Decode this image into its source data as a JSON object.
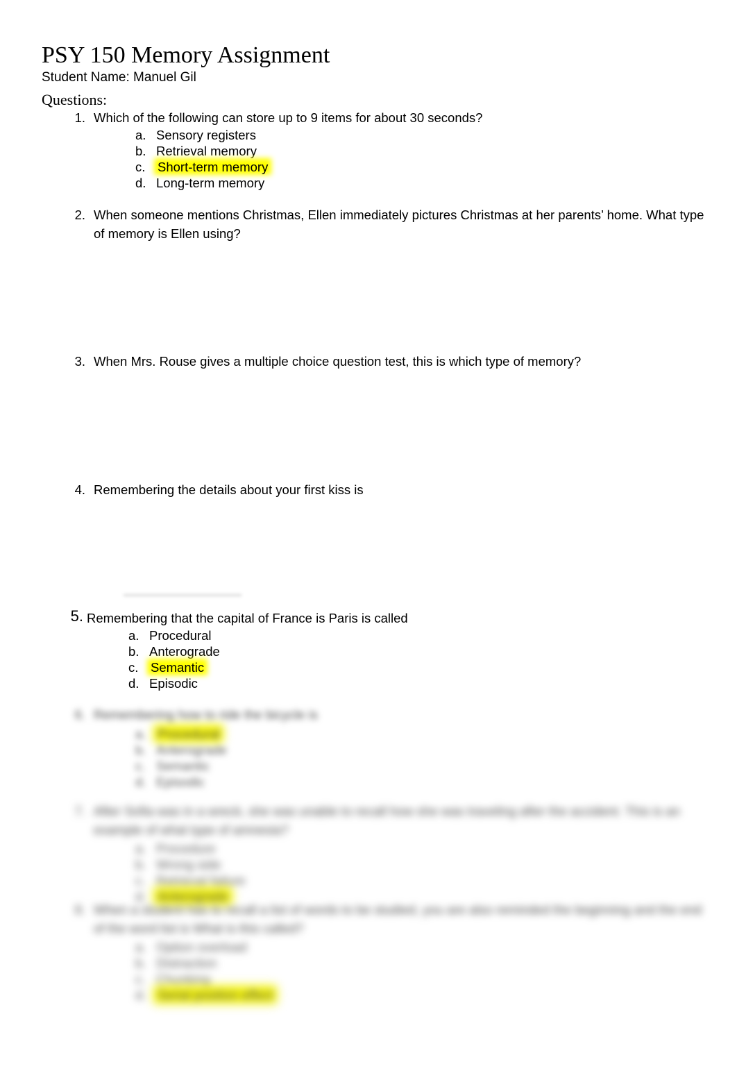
{
  "document": {
    "title_course": "PSY 150 ",
    "title_rest": "Memory Assignment",
    "student_label": "Student Name:  Manuel Gil",
    "questions_label": "Questions:",
    "highlight_color": "#ffff00",
    "text_color": "#000000",
    "page_background": "#ffffff"
  },
  "questions": [
    {
      "number": "1.",
      "text": "Which of the following can store up to 9 items for about 30 seconds?",
      "options": [
        {
          "letter": "a.",
          "text": "Sensory registers",
          "highlighted": false
        },
        {
          "letter": "b.",
          "text": "Retrieval memory",
          "highlighted": false
        },
        {
          "letter": "c.",
          "text": "Short-term memory",
          "highlighted": true
        },
        {
          "letter": "d.",
          "text": "Long-term memory",
          "highlighted": false
        }
      ]
    },
    {
      "number": "2.",
      "text": "When someone mentions Christmas, Ellen immediately pictures Christmas at her parents’ home. What type of memory is Ellen using?",
      "options": []
    },
    {
      "number": "3.",
      "text": "When Mrs. Rouse gives a multiple choice question test, this is which type of memory?",
      "options": []
    },
    {
      "number": "4.",
      "text": "Remembering the details about your first kiss is",
      "options": []
    },
    {
      "number": "5.",
      "text": "Remembering that the capital of France is Paris is called",
      "options": [
        {
          "letter": "a.",
          "text": "Procedural",
          "highlighted": false
        },
        {
          "letter": "b.",
          "text": "Anterograde",
          "highlighted": false
        },
        {
          "letter": "c.",
          "text": "Semantic",
          "highlighted": true
        },
        {
          "letter": "d.",
          "text": "Episodic",
          "highlighted": false
        }
      ]
    }
  ],
  "blurred_questions": [
    {
      "number": "6.",
      "text": "Remembering how to ride the bicycle is",
      "legible": false,
      "options": [
        {
          "letter": "a.",
          "text": "Procedural",
          "highlighted": true
        },
        {
          "letter": "b.",
          "text": "Anterograde",
          "highlighted": false
        },
        {
          "letter": "c.",
          "text": "Semantic",
          "highlighted": false
        },
        {
          "letter": "d.",
          "text": "Episodic",
          "highlighted": false
        }
      ]
    },
    {
      "number": "7.",
      "text": "After Sofia was in a wreck, she was unable to recall how she was traveling after the accident. This is an example of what type of amnesia?",
      "legible": false,
      "options": [
        {
          "letter": "a.",
          "text": "Procedure",
          "highlighted": false
        },
        {
          "letter": "b.",
          "text": "Wrong side",
          "highlighted": false
        },
        {
          "letter": "c.",
          "text": "Retrieval failure",
          "highlighted": false
        },
        {
          "letter": "d.",
          "text": "Anterograde",
          "highlighted": true
        }
      ]
    },
    {
      "number": "8.",
      "text": "When a student has to recall a list of words to be studied, you are also reminded the beginning and the end of the word list is What is this called?",
      "legible": false,
      "options": [
        {
          "letter": "a.",
          "text": "Option overload",
          "highlighted": false
        },
        {
          "letter": "b.",
          "text": "Distraction",
          "highlighted": false
        },
        {
          "letter": "c.",
          "text": "Chunking",
          "highlighted": false
        },
        {
          "letter": "d.",
          "text": "Serial position effect",
          "highlighted": true
        }
      ]
    }
  ]
}
